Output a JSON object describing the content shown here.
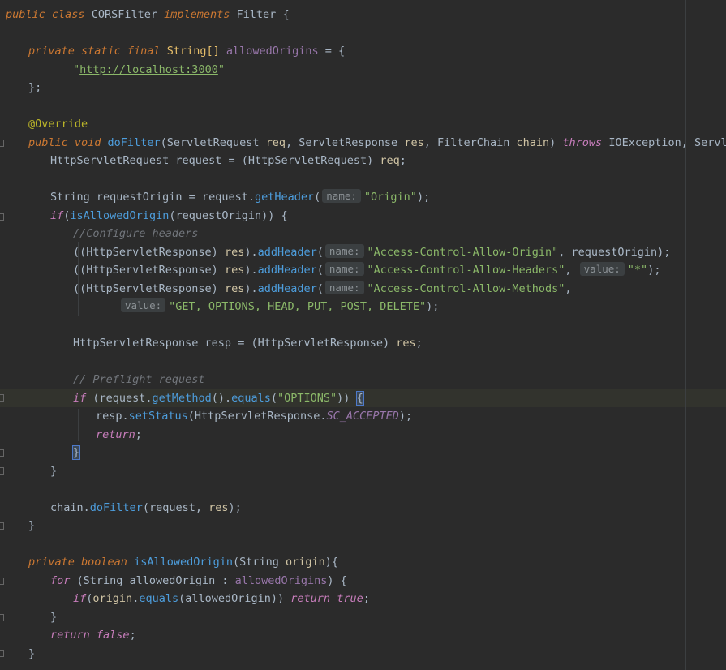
{
  "colors": {
    "background": "#2b2b2b",
    "keyword": "#cc7832",
    "method": "#4d9ddc",
    "string": "#8bb869",
    "comment": "#72767c",
    "annotation": "#bbb529",
    "field": "#9876aa"
  },
  "code": {
    "l1": {
      "public": "public",
      "class": "class",
      "name": "CORSFilter",
      "implements": "implements",
      "iface": "Filter",
      "brace": " {"
    },
    "l3": {
      "mods": "private static final",
      "type": "String[]",
      "field": "allowedOrigins",
      "rest": " = {"
    },
    "l4": {
      "q1": "\"",
      "url": "http://localhost:3000",
      "q2": "\""
    },
    "l5": {
      "text": "};"
    },
    "l7": {
      "ann": "@Override"
    },
    "l8": {
      "mods": "public void",
      "name": "doFilter",
      "p1": "(ServletRequest ",
      "a1": "req",
      "p2": ", ServletResponse ",
      "a2": "res",
      "p3": ", FilterChain ",
      "a3": "chain",
      "p4": ") ",
      "throws": "throws",
      "p5": " IOException, ServletException {"
    },
    "l9": {
      "t1": "HttpServletRequest request = (HttpServletRequest) ",
      "a": "req",
      "t2": ";"
    },
    "l11": {
      "t1": "String requestOrigin = request.",
      "m": "getHeader",
      "t2": "(",
      "hint": "name:",
      "s": "\"Origin\"",
      "t3": ");"
    },
    "l12": {
      "kw": "if",
      "t1": "(",
      "m": "isAllowedOrigin",
      "t2": "(requestOrigin)) {"
    },
    "l13": {
      "cmt": "//Configure headers"
    },
    "l14": {
      "t1": "((HttpServletResponse) ",
      "a": "res",
      "t2": ").",
      "m": "addHeader",
      "t3": "(",
      "hint": "name:",
      "s": "\"Access-Control-Allow-Origin\"",
      "t4": ", requestOrigin);"
    },
    "l15": {
      "t1": "((HttpServletResponse) ",
      "a": "res",
      "t2": ").",
      "m": "addHeader",
      "t3": "(",
      "hint": "name:",
      "s": "\"Access-Control-Allow-Headers\"",
      "t4": ", ",
      "hint2": "value:",
      "s2": "\"*\"",
      "t5": ");"
    },
    "l16": {
      "t1": "((HttpServletResponse) ",
      "a": "res",
      "t2": ").",
      "m": "addHeader",
      "t3": "(",
      "hint": "name:",
      "s": "\"Access-Control-Allow-Methods\"",
      "t4": ","
    },
    "l17": {
      "hint": "value:",
      "s": "\"GET, OPTIONS, HEAD, PUT, POST, DELETE\"",
      "t": ");"
    },
    "l19": {
      "t1": "HttpServletResponse resp = (HttpServletResponse) ",
      "a": "res",
      "t2": ";"
    },
    "l21": {
      "cmt": "// Preflight request"
    },
    "l22": {
      "kw": "if",
      "t1": " (request.",
      "m1": "getMethod",
      "t2": "().",
      "m2": "equals",
      "t3": "(",
      "s": "\"OPTIONS\"",
      "t4": ")) ",
      "b": "{"
    },
    "l23": {
      "t1": "resp.",
      "m": "setStatus",
      "t2": "(HttpServletResponse.",
      "c": "SC_ACCEPTED",
      "t3": ");"
    },
    "l24": {
      "kw": "return",
      "t": ";"
    },
    "l25": {
      "b": "}"
    },
    "l26": {
      "t": "}"
    },
    "l28": {
      "t1": "chain.",
      "m": "doFilter",
      "t2": "(request, ",
      "a": "res",
      "t3": ");"
    },
    "l29": {
      "t": "}"
    },
    "l31": {
      "mods": "private boolean",
      "m": "isAllowedOrigin",
      "t1": "(String ",
      "a": "origin",
      "t2": "){"
    },
    "l32": {
      "kw": "for",
      "t1": " (String allowedOrigin : ",
      "f": "allowedOrigins",
      "t2": ") {"
    },
    "l33": {
      "kw": "if",
      "t1": "(",
      "a": "origin",
      "t2": ".",
      "m": "equals",
      "t3": "(allowedOrigin)) ",
      "kw2": "return",
      "sp": " ",
      "kw3": "true",
      "t4": ";"
    },
    "l34": {
      "t": "}"
    },
    "l35": {
      "kw": "return",
      "sp": " ",
      "kw2": "false",
      "t": ";"
    },
    "l36": {
      "t": "}"
    }
  }
}
